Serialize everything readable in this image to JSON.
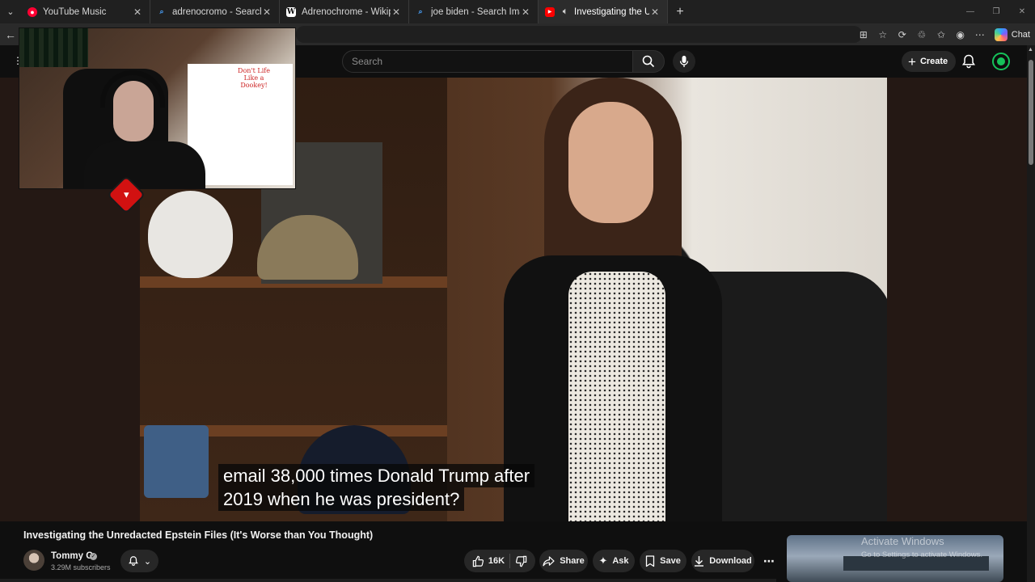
{
  "browser": {
    "tabs": [
      {
        "label": "YouTube Music",
        "favicon": "youtube-music-icon",
        "active": false
      },
      {
        "label": "adrenocromo - Search",
        "favicon": "search-icon",
        "active": false
      },
      {
        "label": "Adrenochrome - Wikipedia",
        "favicon": "wikipedia-icon",
        "active": false
      },
      {
        "label": "joe biden - Search Images",
        "favicon": "search-icon",
        "active": false
      },
      {
        "label": "Investigating the Unredacte",
        "favicon": "youtube-icon",
        "active": true,
        "audio": true
      }
    ],
    "chat_label": "Chat"
  },
  "youtube": {
    "search_placeholder": "Search",
    "create_label": "Create"
  },
  "video": {
    "subtitle_line1": "email 38,000 times Donald Trump after",
    "subtitle_line2": "2019 when he was president?",
    "title": "Investigating the Unredacted Epstein Files (It's Worse than You Thought)",
    "channel_name": "Tommy G",
    "subscribers": "3.29M subscribers",
    "likes": "16K",
    "share_label": "Share",
    "ask_label": "Ask",
    "save_label": "Save",
    "download_label": "Download"
  },
  "webcam": {
    "poster_text": "Don't Life Like a Dookey!"
  },
  "watermark": {
    "title": "Activate Windows",
    "subtitle": "Go to Settings to activate Windows."
  },
  "colors": {
    "youtube_red": "#ff0000",
    "background": "#0f0f0f",
    "accent_green": "#16c25a"
  }
}
